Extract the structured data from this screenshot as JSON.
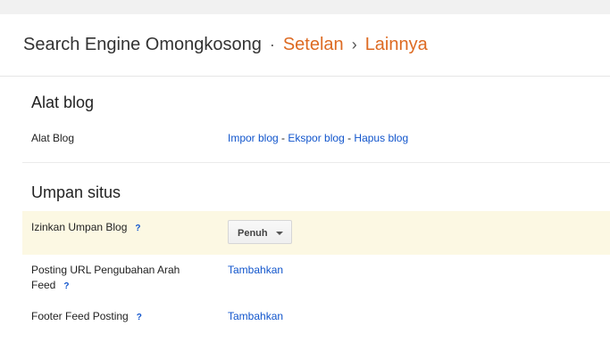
{
  "header": {
    "blog_name": "Search Engine Omongkosong",
    "dot": "·",
    "crumb_settings": "Setelan",
    "chevron": "›",
    "crumb_other": "Lainnya"
  },
  "sections": {
    "blog_tools": {
      "title": "Alat blog",
      "row_label": "Alat Blog",
      "import_link": "Impor blog",
      "export_link": "Ekspor blog",
      "delete_link": "Hapus blog",
      "dash": " - "
    },
    "site_feed": {
      "title": "Umpan situs",
      "allow_feed_label": "Izinkan Umpan Blog",
      "allow_feed_value": "Penuh",
      "redirect_label": "Posting URL Pengubahan Arah Feed",
      "redirect_action": "Tambahkan",
      "footer_label": "Footer Feed Posting",
      "footer_action": "Tambahkan",
      "help_mark": "?"
    }
  },
  "colors": {
    "accent_orange": "#dd6a22",
    "link_blue": "#1155cc",
    "highlight_row": "#fcf8e3"
  }
}
